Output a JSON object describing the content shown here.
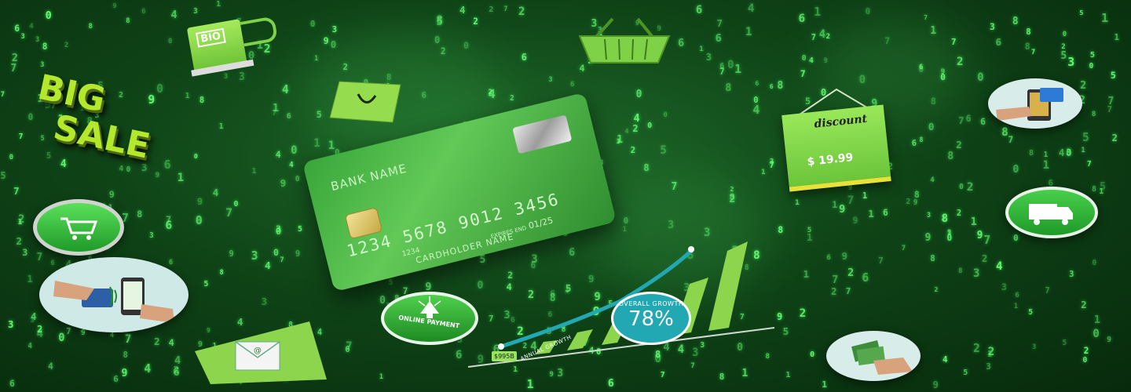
{
  "card": {
    "bank_name": "BANK NAME",
    "number": "1234 5678 9012 3456",
    "small_digits": "1234",
    "expires_label": "EXPIRES END",
    "expiry": "01/25",
    "holder": "CARDHOLDER NAME"
  },
  "bio_pump": {
    "label": "BIO"
  },
  "big_sale": {
    "line1": "BIG",
    "line2": "SALE"
  },
  "discount_tag": {
    "title": "discount",
    "price": "$ 19.99"
  },
  "chart": {
    "start_value": "$995B",
    "curve_label": "ANNUAL GROWTH",
    "overall_label": "OVERALL GROWTH",
    "overall_value": "78%"
  },
  "online_payment": {
    "label": "ONLINE PAYMENT"
  },
  "icons": [
    "bio-pump-icon",
    "shopping-basket-icon",
    "shopping-bag-icon",
    "shopping-cart-icon",
    "mobile-payment-icon",
    "email-icon",
    "delivery-truck-icon",
    "card-payment-icon",
    "cash-payment-icon"
  ],
  "colors": {
    "accent": "#7ed957",
    "digits": "#6dff7a",
    "background": "#0f4417"
  }
}
